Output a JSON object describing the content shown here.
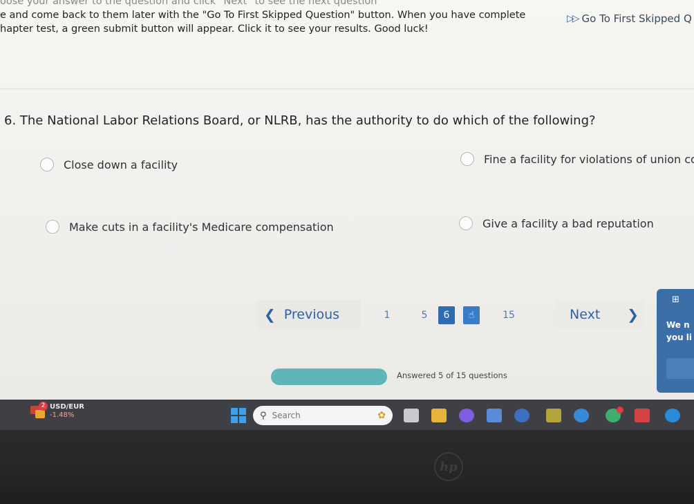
{
  "instructions": {
    "line0": "oose your answer to the question and click \"Next\" to see the next question",
    "line1": "e and come back to them later with the \"Go To First Skipped Question\" button. When you have completed the",
    "line2": "hapter test, a green submit button will appear. Click it to see your results. Good luck!"
  },
  "skip_link": {
    "label": "Go To First Skipped Q",
    "icon": "double-chevron-right-icon"
  },
  "question": {
    "text": "6. The National Labor Relations Board, or NLRB, has the authority to do which of the following?",
    "options": [
      "Close down a facility",
      "Fine a facility for violations of union co",
      "Make cuts in a facility's Medicare compensation",
      "Give a facility a bad reputation"
    ]
  },
  "pager": {
    "previous_label": "Previous",
    "next_label": "Next",
    "pages": [
      "1",
      "5",
      "6",
      "15"
    ],
    "current_page": "6"
  },
  "progress": {
    "text": "Answered 5 of 15 questions",
    "answered": 5,
    "total": 15,
    "color": "#5fb6b8"
  },
  "side_widget": {
    "line1": "We n",
    "line2": "you li"
  },
  "taskbar": {
    "ticker_name": "USD/EUR",
    "ticker_change": "-1.48%",
    "badge": "2",
    "search_placeholder": "Search"
  },
  "colors": {
    "accent": "#2f5fa6",
    "current_page": "#2f6bb0",
    "taskbar": "#3e4045"
  }
}
